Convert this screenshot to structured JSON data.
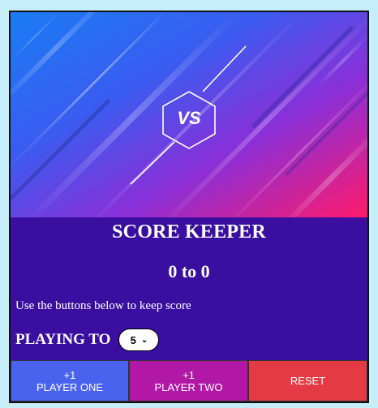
{
  "hero": {
    "badge_text": "VS"
  },
  "title": "SCORE KEEPER",
  "score": {
    "display": "0 to 0"
  },
  "instruction": "Use the buttons below to keep score",
  "playing_to": {
    "label": "PLAYING TO",
    "selected": "5"
  },
  "buttons": {
    "player_one": {
      "line1": "+1",
      "line2": "PLAYER ONE"
    },
    "player_two": {
      "line1": "+1",
      "line2": "PLAYER TWO"
    },
    "reset": {
      "label": "RESET"
    }
  },
  "colors": {
    "page_bg": "#c6eefa",
    "card_bg": "#3a0fa0",
    "player_one_btn": "#4a63ee",
    "player_two_btn": "#b118a6",
    "reset_btn": "#e43a44"
  }
}
